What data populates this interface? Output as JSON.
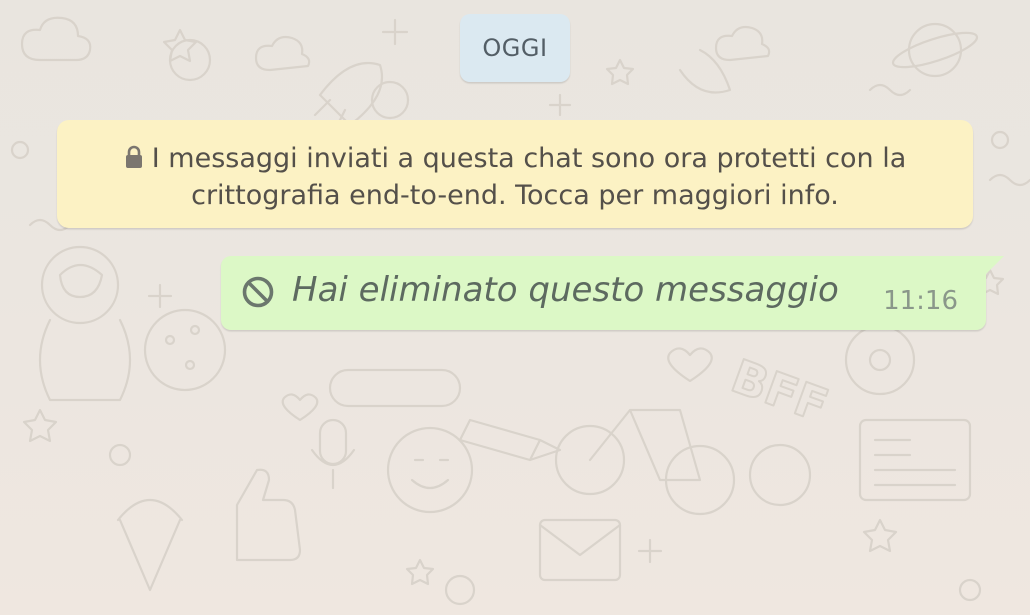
{
  "date_separator": {
    "label": "OGGI"
  },
  "encryption_notice": {
    "icon": "lock-icon",
    "line1": "I messaggi inviati a questa chat sono ora protetti con la",
    "line2": "crittografia end-to-end. Tocca per maggiori info."
  },
  "messages": [
    {
      "type": "deleted",
      "icon": "prohibited-icon",
      "text": "Hai eliminato questo messaggio",
      "time": "11:16",
      "direction": "outgoing"
    }
  ],
  "colors": {
    "chat_background": "#ebe6e0",
    "date_chip": "#dbe9f1",
    "notice_background": "#fcf2c4",
    "outgoing_bubble": "#dcf8c6",
    "deleted_text": "#5d6a60",
    "timestamp": "#8a978a"
  }
}
